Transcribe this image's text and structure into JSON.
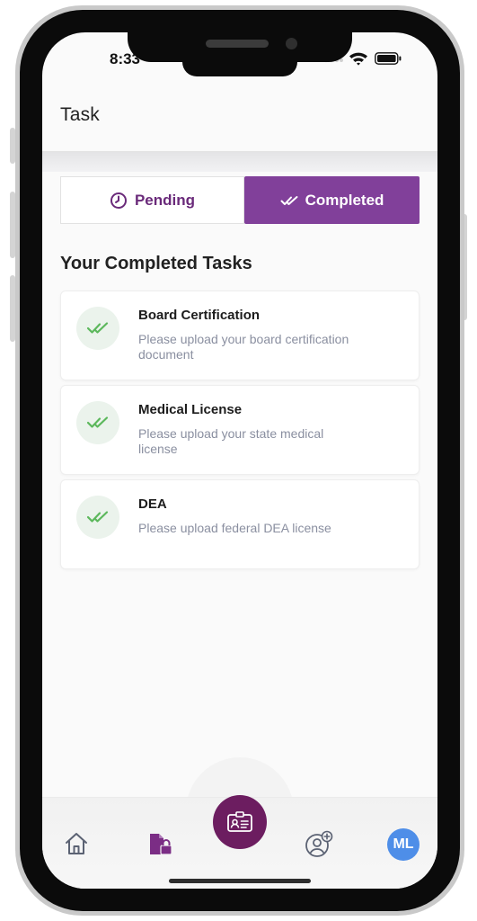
{
  "status_bar": {
    "time": "8:33"
  },
  "header": {
    "title": "Task"
  },
  "tabs": {
    "pending": {
      "label": "Pending",
      "icon": "clock-icon"
    },
    "completed": {
      "label": "Completed",
      "icon": "double-check-icon"
    }
  },
  "section": {
    "title": "Your Completed Tasks"
  },
  "tasks": [
    {
      "title": "Board Certification",
      "description": "Please upload your board certification document",
      "icon": "double-check-icon"
    },
    {
      "title": "Medical License",
      "description": "Please upload your state medical license",
      "icon": "double-check-icon"
    },
    {
      "title": "DEA",
      "description": "Please upload federal DEA license",
      "icon": "double-check-icon"
    }
  ],
  "bottom_nav": {
    "items": [
      "home-icon",
      "documents-lock-icon",
      "id-card-icon",
      "add-user-icon"
    ],
    "avatar_initials": "ML"
  },
  "colors": {
    "accent_purple": "#81409a",
    "nav_center": "#6c1d60",
    "check_green": "#5cb85c",
    "avatar_blue": "#4e8ee8"
  }
}
